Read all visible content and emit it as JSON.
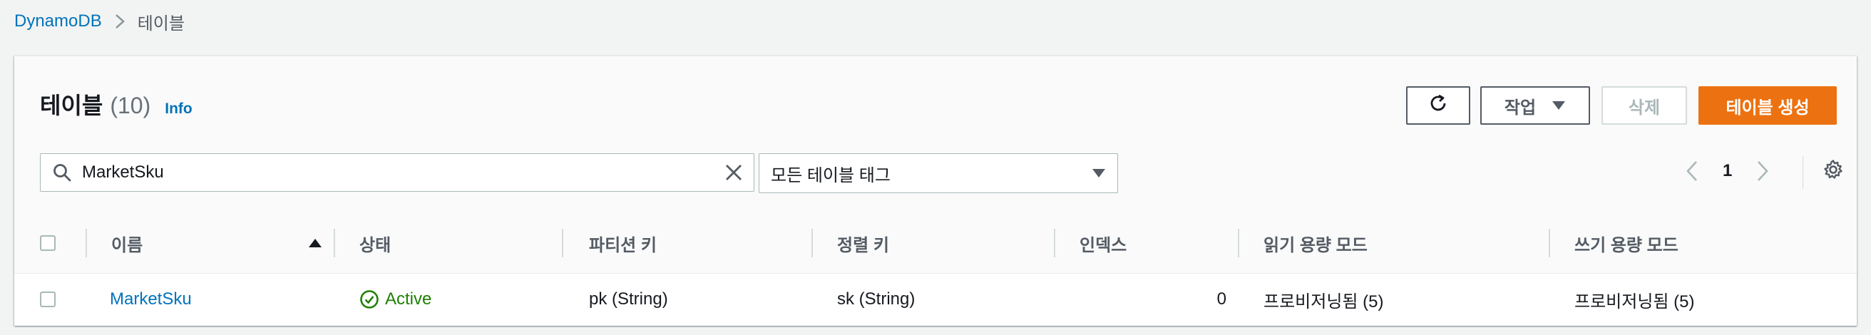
{
  "breadcrumb": {
    "service": "DynamoDB",
    "current": "테이블"
  },
  "panel": {
    "title": "테이블",
    "count": "(10)",
    "info": "Info",
    "buttons": {
      "actions": "작업",
      "delete": "삭제",
      "create": "테이블 생성"
    },
    "search": {
      "value": "MarketSku",
      "placeholder": ""
    },
    "filter": {
      "value": "모든 테이블 태그"
    },
    "pagination": {
      "current": "1"
    }
  },
  "table": {
    "columns": [
      "이름",
      "상태",
      "파티션 키",
      "정렬 키",
      "인덱스",
      "읽기 용량 모드",
      "쓰기 용량 모드"
    ],
    "rows": [
      {
        "name": "MarketSku",
        "status": "Active",
        "partition_key": "pk (String)",
        "sort_key": "sk (String)",
        "indexes": "0",
        "read_capacity": "프로비저닝됨 (5)",
        "write_capacity": "프로비저닝됨 (5)"
      }
    ]
  },
  "colors": {
    "accent": "#ec7211",
    "link": "#0073bb",
    "success": "#1d8102"
  },
  "icons": [
    "chevron-right-icon",
    "refresh-icon",
    "caret-down-icon",
    "search-icon",
    "close-icon",
    "chevron-left-icon",
    "gear-icon",
    "sort-ascending-icon",
    "status-check-icon"
  ]
}
